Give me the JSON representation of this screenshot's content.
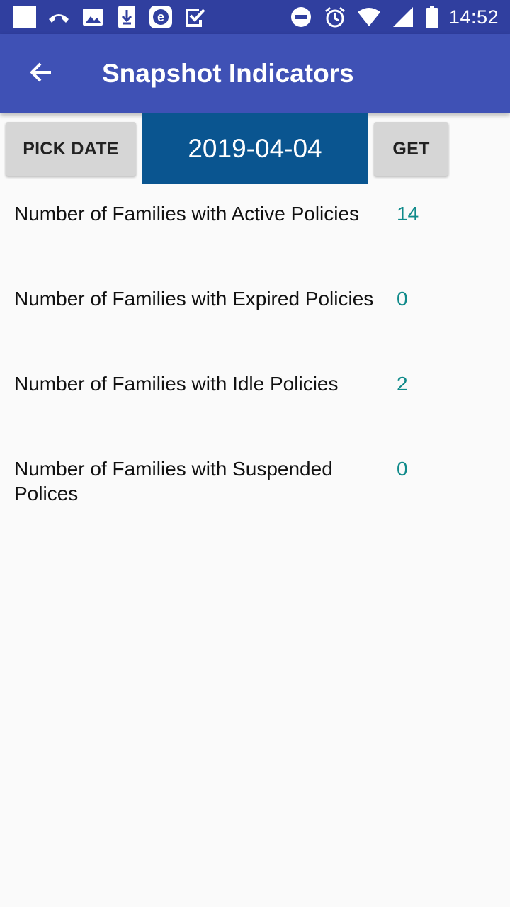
{
  "status_bar": {
    "time": "14:52",
    "left_icons": [
      "square-icon",
      "missed-call-icon",
      "image-icon",
      "download-icon",
      "e-icon",
      "checkbox-icon"
    ],
    "right_icons": [
      "do-not-disturb-icon",
      "alarm-icon",
      "wifi-icon",
      "signal-icon",
      "battery-icon"
    ]
  },
  "app_bar": {
    "title": "Snapshot Indicators",
    "back_icon": "arrow-back-icon"
  },
  "controls": {
    "pick_date_label": "PICK DATE",
    "date_value": "2019-04-04",
    "get_label": "GET"
  },
  "indicators": [
    {
      "label": "Number of Families with Active Policies",
      "value": "14"
    },
    {
      "label": "Number of Families with Expired Policies",
      "value": "0"
    },
    {
      "label": "Number of Families with Idle Policies",
      "value": "2"
    },
    {
      "label": "Number of Families with Suspended Polices",
      "value": "0"
    }
  ],
  "colors": {
    "status_bar": "#303f9f",
    "app_bar": "#3f51b5",
    "date_box": "#0a5590",
    "value_text": "#0f8a8a",
    "button_bg": "#d6d6d6"
  }
}
